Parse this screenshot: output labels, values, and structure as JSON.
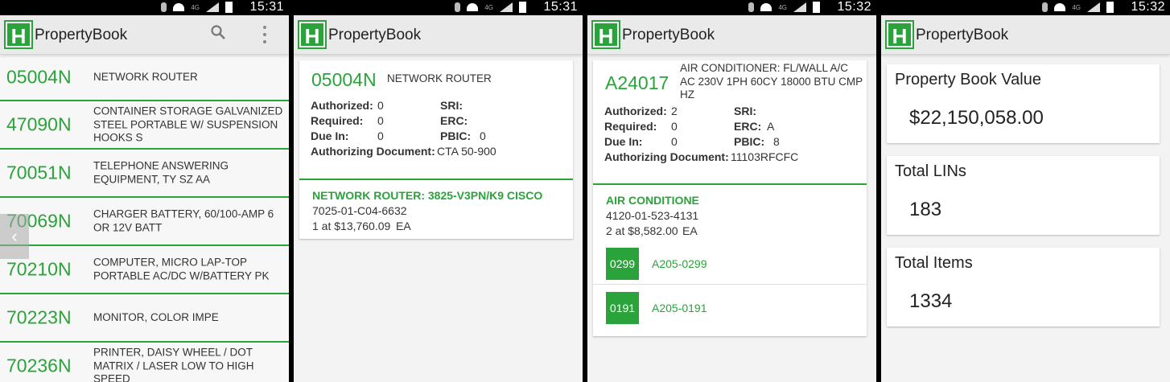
{
  "app": {
    "title": "PropertyBook",
    "logo_letter": "H",
    "accent": "#2aa33b"
  },
  "status_times": [
    "15:31",
    "15:31",
    "15:32",
    "15:32"
  ],
  "list": [
    {
      "lin": "05004N",
      "desc": "NETWORK ROUTER"
    },
    {
      "lin": "47090N",
      "desc": "CONTAINER STORAGE GALVANIZED STEEL PORTABLE W/ SUSPENSION HOOKS S"
    },
    {
      "lin": "70051N",
      "desc": "TELEPHONE ANSWERING EQUIPMENT, TY SZ AA"
    },
    {
      "lin": "70069N",
      "desc": "CHARGER BATTERY, 60/100-AMP 6 OR 12V BATT"
    },
    {
      "lin": "70210N",
      "desc": "COMPUTER, MICRO LAP-TOP PORTABLE AC/DC W/BATTERY PK"
    },
    {
      "lin": "70223N",
      "desc": "MONITOR, COLOR IMPE"
    },
    {
      "lin": "70236N",
      "desc": "PRINTER, DAISY WHEEL / DOT MATRIX / LASER LOW TO HIGH SPEED"
    }
  ],
  "labels": {
    "authorized": "Authorized:",
    "required": "Required:",
    "due_in": "Due In:",
    "auth_doc": "Authorizing Document:",
    "sri": "SRI:",
    "erc": "ERC:",
    "pbic": "PBIC:"
  },
  "detail1": {
    "lin": "05004N",
    "desc": "NETWORK ROUTER",
    "authorized": "0",
    "required": "0",
    "due_in": "0",
    "auth_doc": "CTA 50-900",
    "sri": "",
    "erc": "",
    "pbic": "0",
    "nsn_title": "NETWORK ROUTER: 3825-V3PN/K9 CISCO",
    "nsn": "7025-01-C04-6632",
    "qty_price": "1 at $13,760.09",
    "unit": "EA"
  },
  "detail2": {
    "lin": "A24017",
    "desc": "AIR CONDITIONER: FL/WALL A/C AC 230V 1PH 60CY 18000 BTU CMP HZ",
    "authorized": "2",
    "required": "0",
    "due_in": "0",
    "auth_doc": "11103RFCFC",
    "sri": "",
    "erc": "A",
    "pbic": "8",
    "nsn_title": "AIR CONDITIONE",
    "nsn": "4120-01-523-4131",
    "qty_price": "2 at $8,582.00",
    "unit": "EA",
    "serials": [
      {
        "badge": "0299",
        "id": "A205-0299"
      },
      {
        "badge": "0191",
        "id": "A205-0191"
      }
    ]
  },
  "summary": [
    {
      "label": "Property Book Value",
      "value": "$22,150,058.00"
    },
    {
      "label": "Total LINs",
      "value": "183"
    },
    {
      "label": "Total Items",
      "value": "1334"
    }
  ]
}
